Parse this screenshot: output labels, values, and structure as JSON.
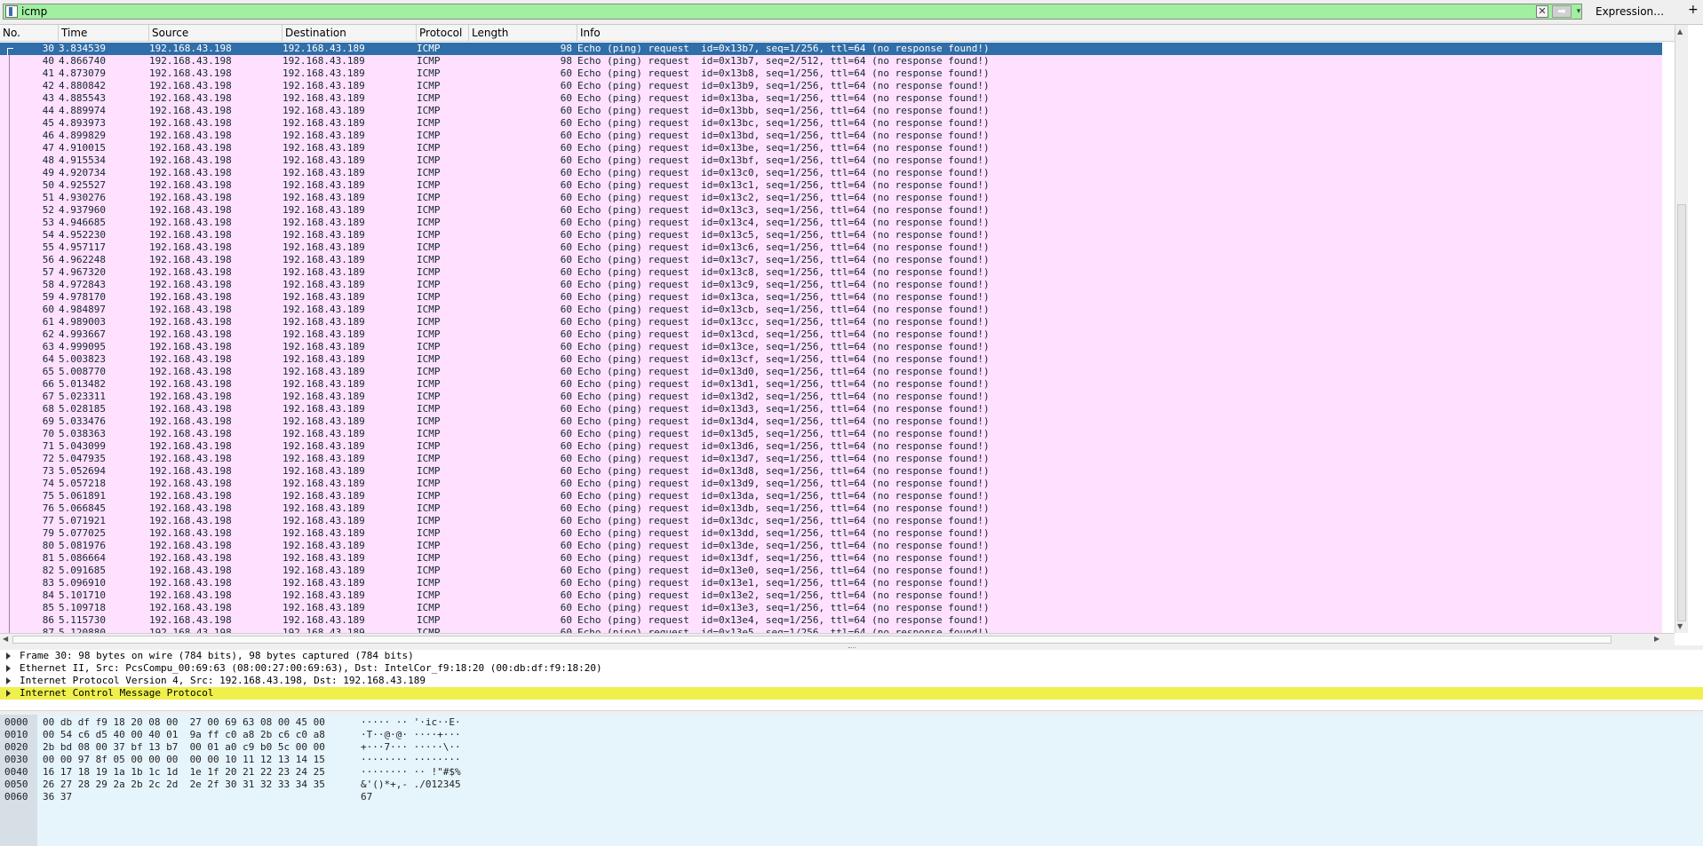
{
  "filter": {
    "value": "icmp",
    "expression_label": "Expression…",
    "plus_label": "+",
    "clear_glyph": "✕",
    "apply_glyph": "➡",
    "dropdown_glyph": "▾"
  },
  "columns": [
    "No.",
    "Time",
    "Source",
    "Destination",
    "Protocol",
    "Length",
    "Info"
  ],
  "packets": [
    {
      "no": "30",
      "time": "3.834539",
      "src": "192.168.43.198",
      "dst": "192.168.43.189",
      "proto": "ICMP",
      "len": "98",
      "info": "Echo (ping) request  id=0x13b7, seq=1/256, ttl=64 (no response found!)",
      "selected": true
    },
    {
      "no": "40",
      "time": "4.866740",
      "src": "192.168.43.198",
      "dst": "192.168.43.189",
      "proto": "ICMP",
      "len": "98",
      "info": "Echo (ping) request  id=0x13b7, seq=2/512, ttl=64 (no response found!)"
    },
    {
      "no": "41",
      "time": "4.873079",
      "src": "192.168.43.198",
      "dst": "192.168.43.189",
      "proto": "ICMP",
      "len": "60",
      "info": "Echo (ping) request  id=0x13b8, seq=1/256, ttl=64 (no response found!)"
    },
    {
      "no": "42",
      "time": "4.880842",
      "src": "192.168.43.198",
      "dst": "192.168.43.189",
      "proto": "ICMP",
      "len": "60",
      "info": "Echo (ping) request  id=0x13b9, seq=1/256, ttl=64 (no response found!)"
    },
    {
      "no": "43",
      "time": "4.885543",
      "src": "192.168.43.198",
      "dst": "192.168.43.189",
      "proto": "ICMP",
      "len": "60",
      "info": "Echo (ping) request  id=0x13ba, seq=1/256, ttl=64 (no response found!)"
    },
    {
      "no": "44",
      "time": "4.889974",
      "src": "192.168.43.198",
      "dst": "192.168.43.189",
      "proto": "ICMP",
      "len": "60",
      "info": "Echo (ping) request  id=0x13bb, seq=1/256, ttl=64 (no response found!)"
    },
    {
      "no": "45",
      "time": "4.893973",
      "src": "192.168.43.198",
      "dst": "192.168.43.189",
      "proto": "ICMP",
      "len": "60",
      "info": "Echo (ping) request  id=0x13bc, seq=1/256, ttl=64 (no response found!)"
    },
    {
      "no": "46",
      "time": "4.899829",
      "src": "192.168.43.198",
      "dst": "192.168.43.189",
      "proto": "ICMP",
      "len": "60",
      "info": "Echo (ping) request  id=0x13bd, seq=1/256, ttl=64 (no response found!)"
    },
    {
      "no": "47",
      "time": "4.910015",
      "src": "192.168.43.198",
      "dst": "192.168.43.189",
      "proto": "ICMP",
      "len": "60",
      "info": "Echo (ping) request  id=0x13be, seq=1/256, ttl=64 (no response found!)"
    },
    {
      "no": "48",
      "time": "4.915534",
      "src": "192.168.43.198",
      "dst": "192.168.43.189",
      "proto": "ICMP",
      "len": "60",
      "info": "Echo (ping) request  id=0x13bf, seq=1/256, ttl=64 (no response found!)"
    },
    {
      "no": "49",
      "time": "4.920734",
      "src": "192.168.43.198",
      "dst": "192.168.43.189",
      "proto": "ICMP",
      "len": "60",
      "info": "Echo (ping) request  id=0x13c0, seq=1/256, ttl=64 (no response found!)"
    },
    {
      "no": "50",
      "time": "4.925527",
      "src": "192.168.43.198",
      "dst": "192.168.43.189",
      "proto": "ICMP",
      "len": "60",
      "info": "Echo (ping) request  id=0x13c1, seq=1/256, ttl=64 (no response found!)"
    },
    {
      "no": "51",
      "time": "4.930276",
      "src": "192.168.43.198",
      "dst": "192.168.43.189",
      "proto": "ICMP",
      "len": "60",
      "info": "Echo (ping) request  id=0x13c2, seq=1/256, ttl=64 (no response found!)"
    },
    {
      "no": "52",
      "time": "4.937960",
      "src": "192.168.43.198",
      "dst": "192.168.43.189",
      "proto": "ICMP",
      "len": "60",
      "info": "Echo (ping) request  id=0x13c3, seq=1/256, ttl=64 (no response found!)"
    },
    {
      "no": "53",
      "time": "4.946685",
      "src": "192.168.43.198",
      "dst": "192.168.43.189",
      "proto": "ICMP",
      "len": "60",
      "info": "Echo (ping) request  id=0x13c4, seq=1/256, ttl=64 (no response found!)"
    },
    {
      "no": "54",
      "time": "4.952230",
      "src": "192.168.43.198",
      "dst": "192.168.43.189",
      "proto": "ICMP",
      "len": "60",
      "info": "Echo (ping) request  id=0x13c5, seq=1/256, ttl=64 (no response found!)"
    },
    {
      "no": "55",
      "time": "4.957117",
      "src": "192.168.43.198",
      "dst": "192.168.43.189",
      "proto": "ICMP",
      "len": "60",
      "info": "Echo (ping) request  id=0x13c6, seq=1/256, ttl=64 (no response found!)"
    },
    {
      "no": "56",
      "time": "4.962248",
      "src": "192.168.43.198",
      "dst": "192.168.43.189",
      "proto": "ICMP",
      "len": "60",
      "info": "Echo (ping) request  id=0x13c7, seq=1/256, ttl=64 (no response found!)"
    },
    {
      "no": "57",
      "time": "4.967320",
      "src": "192.168.43.198",
      "dst": "192.168.43.189",
      "proto": "ICMP",
      "len": "60",
      "info": "Echo (ping) request  id=0x13c8, seq=1/256, ttl=64 (no response found!)"
    },
    {
      "no": "58",
      "time": "4.972843",
      "src": "192.168.43.198",
      "dst": "192.168.43.189",
      "proto": "ICMP",
      "len": "60",
      "info": "Echo (ping) request  id=0x13c9, seq=1/256, ttl=64 (no response found!)"
    },
    {
      "no": "59",
      "time": "4.978170",
      "src": "192.168.43.198",
      "dst": "192.168.43.189",
      "proto": "ICMP",
      "len": "60",
      "info": "Echo (ping) request  id=0x13ca, seq=1/256, ttl=64 (no response found!)"
    },
    {
      "no": "60",
      "time": "4.984897",
      "src": "192.168.43.198",
      "dst": "192.168.43.189",
      "proto": "ICMP",
      "len": "60",
      "info": "Echo (ping) request  id=0x13cb, seq=1/256, ttl=64 (no response found!)"
    },
    {
      "no": "61",
      "time": "4.989003",
      "src": "192.168.43.198",
      "dst": "192.168.43.189",
      "proto": "ICMP",
      "len": "60",
      "info": "Echo (ping) request  id=0x13cc, seq=1/256, ttl=64 (no response found!)"
    },
    {
      "no": "62",
      "time": "4.993667",
      "src": "192.168.43.198",
      "dst": "192.168.43.189",
      "proto": "ICMP",
      "len": "60",
      "info": "Echo (ping) request  id=0x13cd, seq=1/256, ttl=64 (no response found!)"
    },
    {
      "no": "63",
      "time": "4.999095",
      "src": "192.168.43.198",
      "dst": "192.168.43.189",
      "proto": "ICMP",
      "len": "60",
      "info": "Echo (ping) request  id=0x13ce, seq=1/256, ttl=64 (no response found!)"
    },
    {
      "no": "64",
      "time": "5.003823",
      "src": "192.168.43.198",
      "dst": "192.168.43.189",
      "proto": "ICMP",
      "len": "60",
      "info": "Echo (ping) request  id=0x13cf, seq=1/256, ttl=64 (no response found!)"
    },
    {
      "no": "65",
      "time": "5.008770",
      "src": "192.168.43.198",
      "dst": "192.168.43.189",
      "proto": "ICMP",
      "len": "60",
      "info": "Echo (ping) request  id=0x13d0, seq=1/256, ttl=64 (no response found!)"
    },
    {
      "no": "66",
      "time": "5.013482",
      "src": "192.168.43.198",
      "dst": "192.168.43.189",
      "proto": "ICMP",
      "len": "60",
      "info": "Echo (ping) request  id=0x13d1, seq=1/256, ttl=64 (no response found!)"
    },
    {
      "no": "67",
      "time": "5.023311",
      "src": "192.168.43.198",
      "dst": "192.168.43.189",
      "proto": "ICMP",
      "len": "60",
      "info": "Echo (ping) request  id=0x13d2, seq=1/256, ttl=64 (no response found!)"
    },
    {
      "no": "68",
      "time": "5.028185",
      "src": "192.168.43.198",
      "dst": "192.168.43.189",
      "proto": "ICMP",
      "len": "60",
      "info": "Echo (ping) request  id=0x13d3, seq=1/256, ttl=64 (no response found!)"
    },
    {
      "no": "69",
      "time": "5.033476",
      "src": "192.168.43.198",
      "dst": "192.168.43.189",
      "proto": "ICMP",
      "len": "60",
      "info": "Echo (ping) request  id=0x13d4, seq=1/256, ttl=64 (no response found!)"
    },
    {
      "no": "70",
      "time": "5.038363",
      "src": "192.168.43.198",
      "dst": "192.168.43.189",
      "proto": "ICMP",
      "len": "60",
      "info": "Echo (ping) request  id=0x13d5, seq=1/256, ttl=64 (no response found!)"
    },
    {
      "no": "71",
      "time": "5.043099",
      "src": "192.168.43.198",
      "dst": "192.168.43.189",
      "proto": "ICMP",
      "len": "60",
      "info": "Echo (ping) request  id=0x13d6, seq=1/256, ttl=64 (no response found!)"
    },
    {
      "no": "72",
      "time": "5.047935",
      "src": "192.168.43.198",
      "dst": "192.168.43.189",
      "proto": "ICMP",
      "len": "60",
      "info": "Echo (ping) request  id=0x13d7, seq=1/256, ttl=64 (no response found!)"
    },
    {
      "no": "73",
      "time": "5.052694",
      "src": "192.168.43.198",
      "dst": "192.168.43.189",
      "proto": "ICMP",
      "len": "60",
      "info": "Echo (ping) request  id=0x13d8, seq=1/256, ttl=64 (no response found!)"
    },
    {
      "no": "74",
      "time": "5.057218",
      "src": "192.168.43.198",
      "dst": "192.168.43.189",
      "proto": "ICMP",
      "len": "60",
      "info": "Echo (ping) request  id=0x13d9, seq=1/256, ttl=64 (no response found!)"
    },
    {
      "no": "75",
      "time": "5.061891",
      "src": "192.168.43.198",
      "dst": "192.168.43.189",
      "proto": "ICMP",
      "len": "60",
      "info": "Echo (ping) request  id=0x13da, seq=1/256, ttl=64 (no response found!)"
    },
    {
      "no": "76",
      "time": "5.066845",
      "src": "192.168.43.198",
      "dst": "192.168.43.189",
      "proto": "ICMP",
      "len": "60",
      "info": "Echo (ping) request  id=0x13db, seq=1/256, ttl=64 (no response found!)"
    },
    {
      "no": "77",
      "time": "5.071921",
      "src": "192.168.43.198",
      "dst": "192.168.43.189",
      "proto": "ICMP",
      "len": "60",
      "info": "Echo (ping) request  id=0x13dc, seq=1/256, ttl=64 (no response found!)"
    },
    {
      "no": "79",
      "time": "5.077025",
      "src": "192.168.43.198",
      "dst": "192.168.43.189",
      "proto": "ICMP",
      "len": "60",
      "info": "Echo (ping) request  id=0x13dd, seq=1/256, ttl=64 (no response found!)"
    },
    {
      "no": "80",
      "time": "5.081976",
      "src": "192.168.43.198",
      "dst": "192.168.43.189",
      "proto": "ICMP",
      "len": "60",
      "info": "Echo (ping) request  id=0x13de, seq=1/256, ttl=64 (no response found!)"
    },
    {
      "no": "81",
      "time": "5.086664",
      "src": "192.168.43.198",
      "dst": "192.168.43.189",
      "proto": "ICMP",
      "len": "60",
      "info": "Echo (ping) request  id=0x13df, seq=1/256, ttl=64 (no response found!)"
    },
    {
      "no": "82",
      "time": "5.091685",
      "src": "192.168.43.198",
      "dst": "192.168.43.189",
      "proto": "ICMP",
      "len": "60",
      "info": "Echo (ping) request  id=0x13e0, seq=1/256, ttl=64 (no response found!)"
    },
    {
      "no": "83",
      "time": "5.096910",
      "src": "192.168.43.198",
      "dst": "192.168.43.189",
      "proto": "ICMP",
      "len": "60",
      "info": "Echo (ping) request  id=0x13e1, seq=1/256, ttl=64 (no response found!)"
    },
    {
      "no": "84",
      "time": "5.101710",
      "src": "192.168.43.198",
      "dst": "192.168.43.189",
      "proto": "ICMP",
      "len": "60",
      "info": "Echo (ping) request  id=0x13e2, seq=1/256, ttl=64 (no response found!)"
    },
    {
      "no": "85",
      "time": "5.109718",
      "src": "192.168.43.198",
      "dst": "192.168.43.189",
      "proto": "ICMP",
      "len": "60",
      "info": "Echo (ping) request  id=0x13e3, seq=1/256, ttl=64 (no response found!)"
    },
    {
      "no": "86",
      "time": "5.115730",
      "src": "192.168.43.198",
      "dst": "192.168.43.189",
      "proto": "ICMP",
      "len": "60",
      "info": "Echo (ping) request  id=0x13e4, seq=1/256, ttl=64 (no response found!)"
    },
    {
      "no": "87",
      "time": "5.120880",
      "src": "192.168.43.198",
      "dst": "192.168.43.189",
      "proto": "ICMP",
      "len": "60",
      "info": "Echo (ping) request  id=0x13e5, seq=1/256, ttl=64 (no response found!)"
    }
  ],
  "details": [
    {
      "text": "Frame 30: 98 bytes on wire (784 bits), 98 bytes captured (784 bits)",
      "highlight": false
    },
    {
      "text": "Ethernet II, Src: PcsCompu_00:69:63 (08:00:27:00:69:63), Dst: IntelCor_f9:18:20 (00:db:df:f9:18:20)",
      "highlight": false
    },
    {
      "text": "Internet Protocol Version 4, Src: 192.168.43.198, Dst: 192.168.43.189",
      "highlight": false
    },
    {
      "text": "Internet Control Message Protocol",
      "highlight": true
    }
  ],
  "bytes": [
    {
      "offset": "0000",
      "hex": "00 db df f9 18 20 08 00  27 00 69 63 08 00 45 00",
      "ascii": "····· ·· '·ic··E·"
    },
    {
      "offset": "0010",
      "hex": "00 54 c6 d5 40 00 40 01  9a ff c0 a8 2b c6 c0 a8",
      "ascii": "·T··@·@· ····+···"
    },
    {
      "offset": "0020",
      "hex": "2b bd 08 00 37 bf 13 b7  00 01 a0 c9 b0 5c 00 00",
      "ascii": "+···7··· ·····\\··"
    },
    {
      "offset": "0030",
      "hex": "00 00 97 8f 05 00 00 00  00 00 10 11 12 13 14 15",
      "ascii": "········ ········"
    },
    {
      "offset": "0040",
      "hex": "16 17 18 19 1a 1b 1c 1d  1e 1f 20 21 22 23 24 25",
      "ascii": "········ ·· !\"#$%"
    },
    {
      "offset": "0050",
      "hex": "26 27 28 29 2a 2b 2c 2d  2e 2f 30 31 32 33 34 35",
      "ascii": "&'()*+,- ./012345"
    },
    {
      "offset": "0060",
      "hex": "36 37",
      "ascii": "67"
    }
  ],
  "colors": {
    "filter_valid": "#a0f0a0",
    "row_icmp": "#ffe0ff",
    "row_selected": "#2f6ea8",
    "detail_highlight": "#f0f04c",
    "bytes_bg": "#e6f4fb"
  }
}
